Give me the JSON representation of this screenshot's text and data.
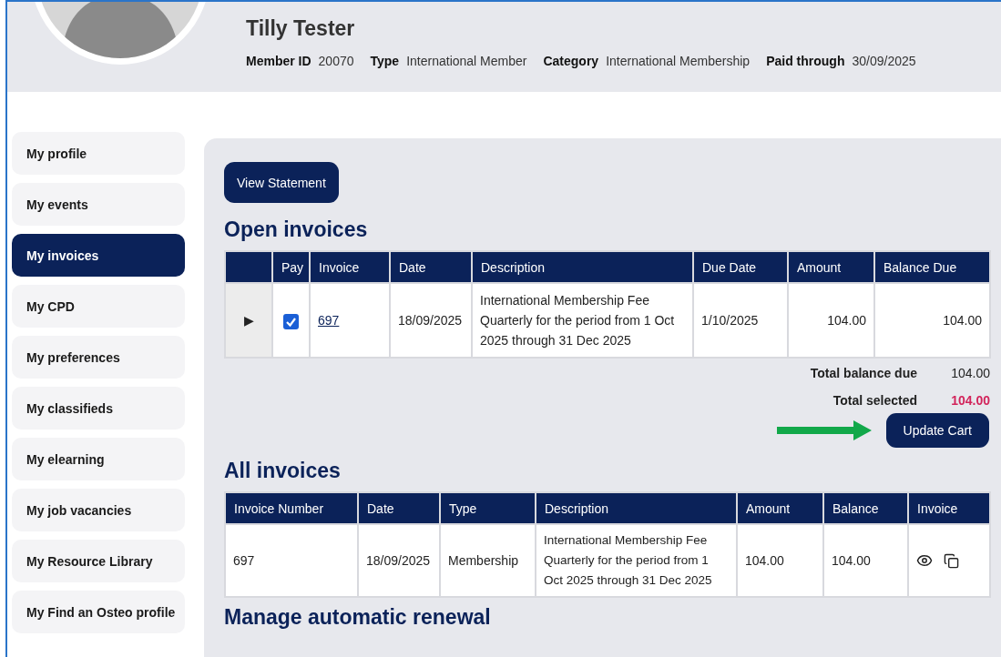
{
  "member": {
    "name": "Tilly Tester",
    "fields": [
      {
        "label": "Member ID",
        "value": "20070"
      },
      {
        "label": "Type",
        "value": "International Member"
      },
      {
        "label": "Category",
        "value": "International Membership"
      },
      {
        "label": "Paid through",
        "value": "30/09/2025"
      }
    ]
  },
  "sidebar": {
    "items": [
      {
        "label": "My profile",
        "selected": false
      },
      {
        "label": "My events",
        "selected": false
      },
      {
        "label": "My invoices",
        "selected": true
      },
      {
        "label": "My CPD",
        "selected": false
      },
      {
        "label": "My preferences",
        "selected": false
      },
      {
        "label": "My classifieds",
        "selected": false
      },
      {
        "label": "My elearning",
        "selected": false
      },
      {
        "label": "My job vacancies",
        "selected": false
      },
      {
        "label": "My Resource Library",
        "selected": false
      },
      {
        "label": "My Find an Osteo profile",
        "selected": false
      }
    ]
  },
  "view_statement_button": "View Statement",
  "open_invoices": {
    "title": "Open invoices",
    "columns": [
      "Pay",
      "Invoice",
      "Date",
      "Description",
      "Due Date",
      "Amount",
      "Balance Due"
    ],
    "rows": [
      {
        "expander": "▶",
        "checked": true,
        "invoice": "697",
        "date": "18/09/2025",
        "description": "International Membership Fee Quarterly for the period from 1 Oct 2025 through 31 Dec 2025",
        "due_date": "1/10/2025",
        "amount": "104.00",
        "balance_due": "104.00"
      }
    ],
    "totals": [
      {
        "label": "Total balance due",
        "value": "104.00",
        "highlight": false
      },
      {
        "label": "Total selected",
        "value": "104.00",
        "highlight": true
      }
    ],
    "update_button": "Update Cart"
  },
  "all_invoices": {
    "title": "All invoices",
    "columns": [
      "Invoice Number",
      "Date",
      "Type",
      "Description",
      "Amount",
      "Balance",
      "Invoice"
    ],
    "rows": [
      {
        "invoice_number": "697",
        "date": "18/09/2025",
        "type": "Membership",
        "description": "International Membership Fee Quarterly for the period from 1 Oct 2025 through 31 Dec 2025",
        "amount": "104.00",
        "balance": "104.00"
      }
    ]
  },
  "next_section_title": "Manage automatic renewal"
}
